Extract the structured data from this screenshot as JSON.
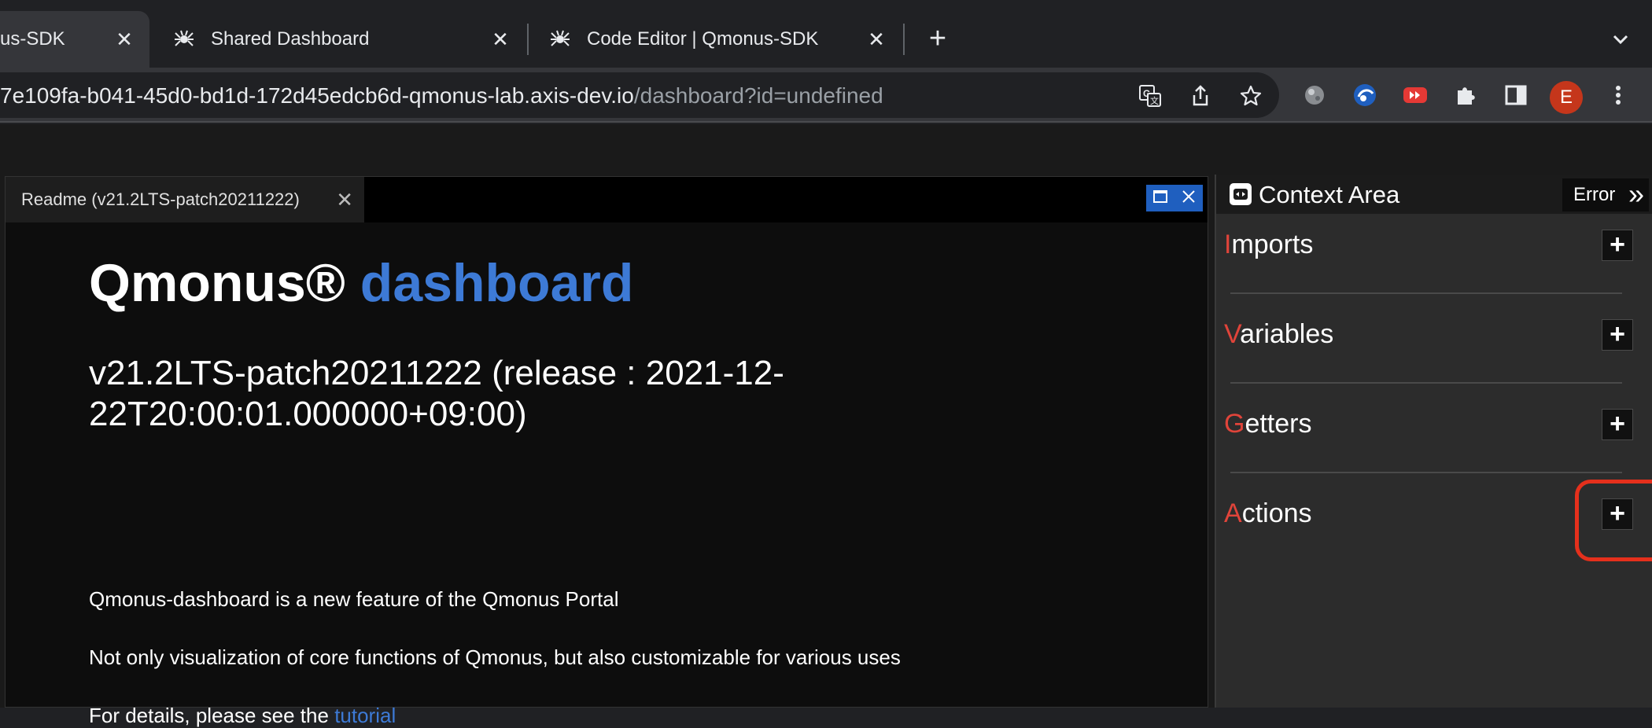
{
  "tabs": [
    {
      "title": "us-SDK",
      "active": true
    },
    {
      "title": "Shared Dashboard",
      "active": false
    },
    {
      "title": "Code Editor | Qmonus-SDK",
      "active": false
    }
  ],
  "new_tab_label": "+",
  "address_bar": {
    "host": "7e109fa-b041-45d0-bd1d-172d45edcb6d-qmonus-lab.axis-dev.io",
    "path": "/dashboard?id=undefined"
  },
  "profile": {
    "initial": "E"
  },
  "panel": {
    "tab_label": "Readme (v21.2LTS-patch20211222)",
    "heading_main": "Qmonus®",
    "heading_accent": "dashboard",
    "version_line": "v21.2LTS-patch20211222 (release : 2021-12-22T20:00:01.000000+09:00)",
    "paragraph_1": "Qmonus-dashboard is a new feature of the Qmonus Portal",
    "paragraph_2": "Not only visualization of core functions of Qmonus, but also customizable for various uses",
    "paragraph_3_prefix": "For details, please see the ",
    "paragraph_3_link": "tutorial"
  },
  "context_area": {
    "title": "Context Area",
    "error_label": "Error",
    "sections": [
      {
        "first": "I",
        "rest": "mports"
      },
      {
        "first": "V",
        "rest": "ariables"
      },
      {
        "first": "G",
        "rest": "etters"
      },
      {
        "first": "A",
        "rest": "ctions"
      }
    ],
    "add_label": "+"
  },
  "colors": {
    "accent_blue": "#3d7ad6",
    "section_initial_red": "#e0443a",
    "highlight_red": "#e5301c",
    "avatar": "#c5361b"
  }
}
